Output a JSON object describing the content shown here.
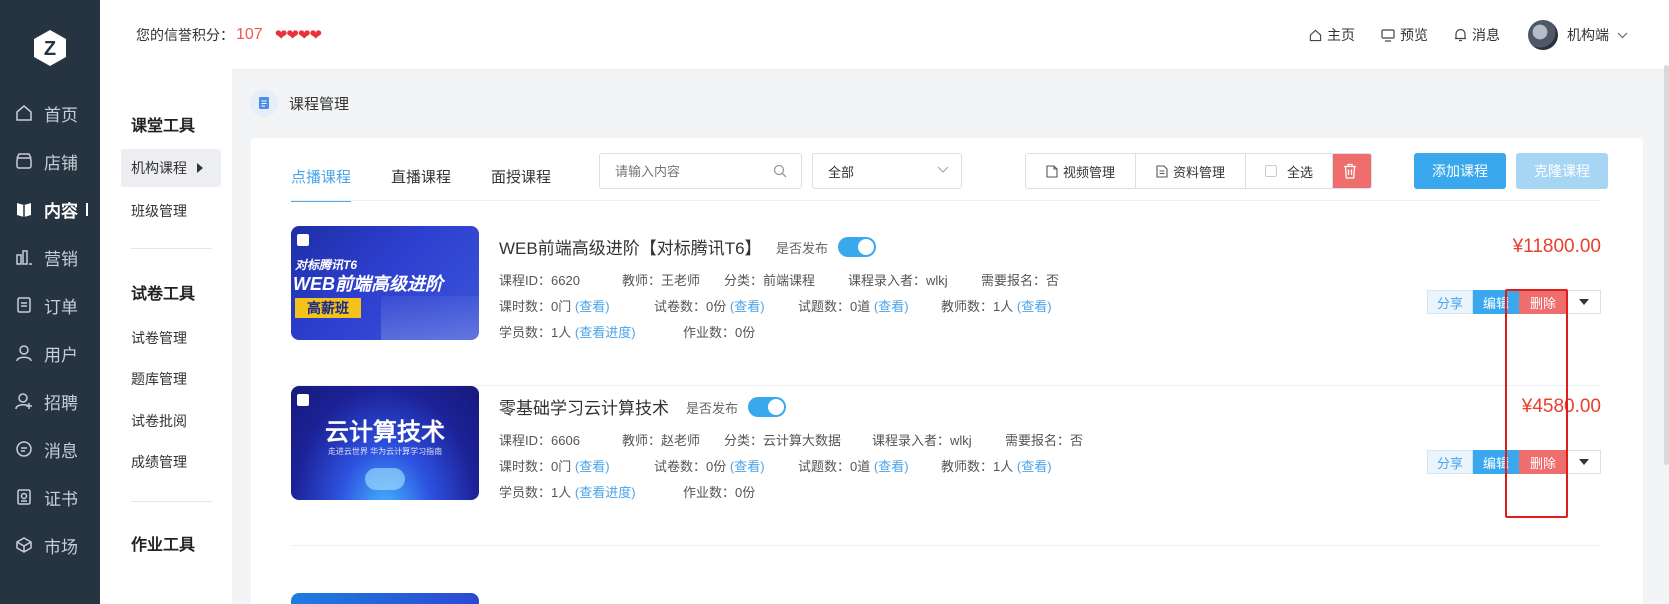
{
  "nav": {
    "items": [
      {
        "label": "首页",
        "icon": "home-icon"
      },
      {
        "label": "店铺",
        "icon": "store-icon"
      },
      {
        "label": "内容",
        "icon": "book-icon"
      },
      {
        "label": "营销",
        "icon": "chart-icon"
      },
      {
        "label": "订单",
        "icon": "order-icon"
      },
      {
        "label": "用户",
        "icon": "user-icon"
      },
      {
        "label": "招聘",
        "icon": "recruit-icon"
      },
      {
        "label": "消息",
        "icon": "message-icon"
      },
      {
        "label": "证书",
        "icon": "certificate-icon"
      },
      {
        "label": "市场",
        "icon": "market-icon"
      }
    ],
    "active": "内容"
  },
  "header": {
    "credit_label": "您的信誉积分：",
    "credit_score": "107",
    "hearts": "❤❤❤❤",
    "links": {
      "home": "主页",
      "preview": "预览",
      "message": "消息"
    },
    "account": "机构端"
  },
  "sidebar": {
    "group1_title": "课堂工具",
    "group1_items": [
      "机构课程",
      "班级管理"
    ],
    "group2_title": "试卷工具",
    "group2_items": [
      "试卷管理",
      "题库管理",
      "试卷批阅",
      "成绩管理"
    ],
    "group3_title": "作业工具"
  },
  "breadcrumb": "课程管理",
  "tabs": [
    "点播课程",
    "直播课程",
    "面授课程"
  ],
  "search": {
    "placeholder": "请输入内容"
  },
  "filter": {
    "selected": "全部"
  },
  "toolbar": {
    "video": "视频管理",
    "material": "资料管理",
    "select_all": "全选",
    "add": "添加课程",
    "clone": "克隆课程"
  },
  "labels": {
    "publish": "是否发布",
    "course_id": "课程ID：",
    "teacher": "教师：",
    "category": "分类：",
    "recorder": "课程录入者：",
    "signup": "需要报名：",
    "lessons": "课时数：",
    "papers": "试卷数：",
    "questions": "试题数：",
    "teachers": "教师数：",
    "students": "学员数：",
    "homework": "作业数：",
    "view": "(查看)",
    "view_progress": "(查看进度)",
    "share": "分享",
    "edit": "编辑",
    "delete": "删除"
  },
  "courses": [
    {
      "title": "WEB前端高级进阶【对标腾讯T6】",
      "published": true,
      "price": "¥11800.00",
      "id": "6620",
      "teacher": "王老师",
      "category": "前端课程",
      "recorder": "wlkj",
      "signup": "否",
      "lessons": "0门",
      "papers": "0份",
      "questions": "0道",
      "teachers": "1人",
      "students": "1人",
      "homework": "0份",
      "thumb": {
        "line1": "对标腾讯T6",
        "line2": "WEB前端高级进阶",
        "line3": "高薪班"
      }
    },
    {
      "title": "零基础学习云计算技术",
      "published": true,
      "price": "¥4580.00",
      "id": "6606",
      "teacher": "赵老师",
      "category": "云计算大数据",
      "recorder": "wlkj",
      "signup": "否",
      "lessons": "0门",
      "papers": "0份",
      "questions": "0道",
      "teachers": "1人",
      "students": "1人",
      "homework": "0份",
      "thumb": {
        "line1": "云计算技术",
        "line2": "走进云世界 华为云计算学习指南"
      }
    }
  ],
  "colors": {
    "primary": "#3aa8ec",
    "danger": "#ee6e6e",
    "price": "#e8402e",
    "nav_bg": "#263340",
    "highlight_box": "#e21b1b"
  }
}
